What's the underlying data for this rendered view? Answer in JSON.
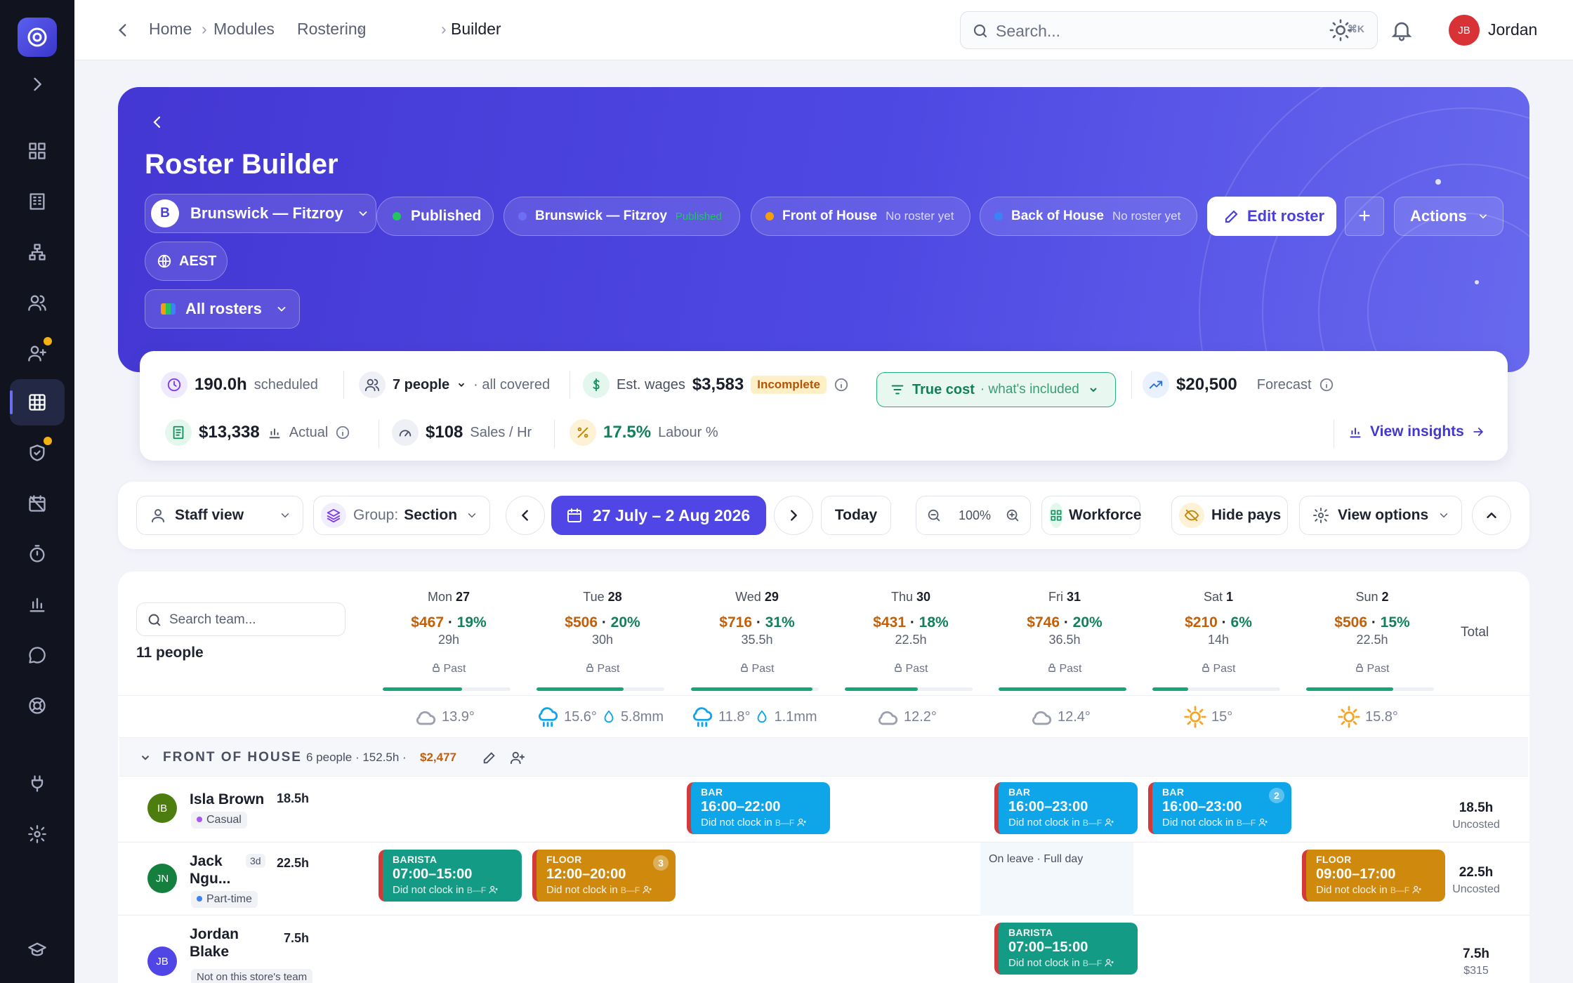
{
  "breadcrumb": [
    "Home",
    "Modules",
    "Rostering",
    "Builder"
  ],
  "search": {
    "placeholder": "Search...",
    "shortcut": "⌘K"
  },
  "user": {
    "initials": "JB",
    "name": "Jordan"
  },
  "hero": {
    "title": "Roster Builder",
    "location": {
      "badge": "B",
      "name": "Brunswick — Fitzroy"
    },
    "status": "Published",
    "rosters": [
      {
        "name": "Brunswick — Fitzroy",
        "note": "Published",
        "dot": "#6c6ff5"
      },
      {
        "name": "Front of House",
        "note": "No roster yet",
        "dot": "#f59e0b"
      },
      {
        "name": "Back of House",
        "note": "No roster yet",
        "dot": "#3b82f6"
      }
    ],
    "edit": "Edit roster",
    "plus": "+",
    "actions": "Actions",
    "timezone": "AEST",
    "all_rosters": "All rosters"
  },
  "stats": {
    "scheduled_val": "190.0h",
    "scheduled_lbl": "scheduled",
    "people_val": "7 people",
    "people_lbl": "· all covered",
    "wages_lbl": "Est. wages",
    "wages_val": "$3,583",
    "incomplete": "Incomplete",
    "truecost": "True cost",
    "truecost_sub": "· what's included",
    "forecast_val": "$20,500",
    "forecast_lbl": "Forecast",
    "actual_val": "$13,338",
    "actual_lbl": "Actual",
    "sales_val": "$108",
    "sales_lbl": "Sales / Hr",
    "labour_val": "17.5%",
    "labour_lbl": "Labour %",
    "insights": "View insights"
  },
  "toolbar": {
    "staff_view": "Staff view",
    "group_lbl": "Group:",
    "group_val": "Section",
    "range": "27 July – 2 Aug 2026",
    "today": "Today",
    "zoom": "100%",
    "workforce": "Workforce",
    "hide_pays": "Hide pays",
    "view_options": "View options"
  },
  "grid": {
    "search_placeholder": "Search team...",
    "people_count": "11 people",
    "total_lbl": "Total",
    "days": [
      {
        "dow": "Mon",
        "date": "27",
        "cost": "$467",
        "pct": "19%",
        "hours": "29h",
        "past": "Past",
        "progress": 0.62,
        "weather": "cloud",
        "temp": "13.9°",
        "rain": ""
      },
      {
        "dow": "Tue",
        "date": "28",
        "cost": "$506",
        "pct": "20%",
        "hours": "30h",
        "past": "Past",
        "progress": 0.68,
        "weather": "rain",
        "temp": "15.6°",
        "rain": "5.8mm"
      },
      {
        "dow": "Wed",
        "date": "29",
        "cost": "$716",
        "pct": "31%",
        "hours": "35.5h",
        "past": "Past",
        "progress": 0.95,
        "weather": "rain",
        "temp": "11.8°",
        "rain": "1.1mm"
      },
      {
        "dow": "Thu",
        "date": "30",
        "cost": "$431",
        "pct": "18%",
        "hours": "22.5h",
        "past": "Past",
        "progress": 0.57,
        "weather": "cloud",
        "temp": "12.2°",
        "rain": ""
      },
      {
        "dow": "Fri",
        "date": "31",
        "cost": "$746",
        "pct": "20%",
        "hours": "36.5h",
        "past": "Past",
        "progress": 1.0,
        "weather": "cloud",
        "temp": "12.4°",
        "rain": ""
      },
      {
        "dow": "Sat",
        "date": "1",
        "cost": "$210",
        "pct": "6%",
        "hours": "14h",
        "past": "Past",
        "progress": 0.28,
        "weather": "sun",
        "temp": "15°",
        "rain": ""
      },
      {
        "dow": "Sun",
        "date": "2",
        "cost": "$506",
        "pct": "15%",
        "hours": "22.5h",
        "past": "Past",
        "progress": 0.68,
        "weather": "sun",
        "temp": "15.8°",
        "rain": ""
      }
    ],
    "section": {
      "name": "FRONT OF HOUSE",
      "meta": "6 people · 152.5h ·",
      "cost": "$2,477"
    },
    "rows": [
      {
        "initials": "IB",
        "name": "Isla Brown",
        "hours": "18.5h",
        "type": "Casual",
        "type_color": "#a855f7",
        "total": "18.5h",
        "total_sub": "Uncosted",
        "shifts": [
          {
            "day": 2,
            "color": "blue",
            "role": "BAR",
            "time": "16:00–22:00",
            "note": "Did not clock in",
            "badge": ""
          },
          {
            "day": 4,
            "color": "blue",
            "role": "BAR",
            "time": "16:00–23:00",
            "note": "Did not clock in",
            "badge": ""
          },
          {
            "day": 5,
            "color": "blue",
            "role": "BAR",
            "time": "16:00–23:00",
            "note": "Did not clock in",
            "badge": "2"
          }
        ]
      },
      {
        "initials": "JN",
        "name1": "Jack",
        "name2": "Ngu...",
        "tenure": "3d",
        "hours": "22.5h",
        "type": "Part-time",
        "type_color": "#3b82f6",
        "total": "22.5h",
        "total_sub": "Uncosted",
        "leave": "On leave · Full day",
        "shifts": [
          {
            "day": 0,
            "color": "teal",
            "role": "BARISTA",
            "time": "07:00–15:00",
            "note": "Did not clock in",
            "badge": ""
          },
          {
            "day": 1,
            "color": "amber",
            "role": "FLOOR",
            "time": "12:00–20:00",
            "note": "Did not clock in",
            "badge": "3"
          },
          {
            "day": 6,
            "color": "amber",
            "role": "FLOOR",
            "time": "09:00–17:00",
            "note": "Did not clock in",
            "badge": ""
          }
        ]
      },
      {
        "initials": "JB",
        "name1": "Jordan",
        "name2": "Blake",
        "hours": "7.5h",
        "note": "Not on this store's team",
        "total": "7.5h",
        "total_sub": "$315",
        "shifts": [
          {
            "day": 4,
            "color": "teal",
            "role": "BARISTA",
            "time": "07:00–15:00",
            "note": "Did not clock in",
            "badge": ""
          }
        ]
      }
    ],
    "shift_code": "B—F"
  },
  "colors": {
    "accent": "#4f46e5",
    "hero": "#4a3fdc",
    "teal": "#149b85",
    "amber": "#cf8a0e",
    "blue": "#0ea5e9"
  }
}
